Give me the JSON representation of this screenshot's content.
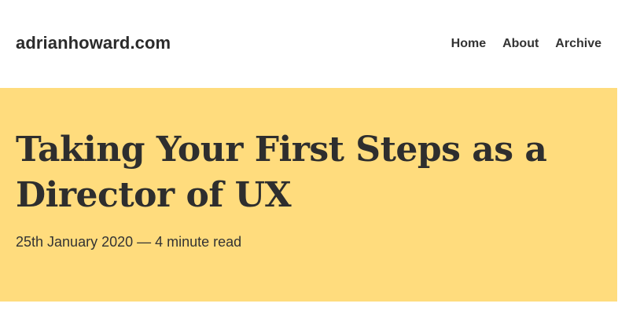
{
  "header": {
    "site_title": "adrianhoward.com",
    "nav": [
      {
        "label": "Home"
      },
      {
        "label": "About"
      },
      {
        "label": "Archive"
      }
    ]
  },
  "hero": {
    "background_color": "#ffdc7d",
    "title": "Taking Your First Steps as a Director of UX",
    "meta": "25th January 2020 — 4 minute read"
  }
}
